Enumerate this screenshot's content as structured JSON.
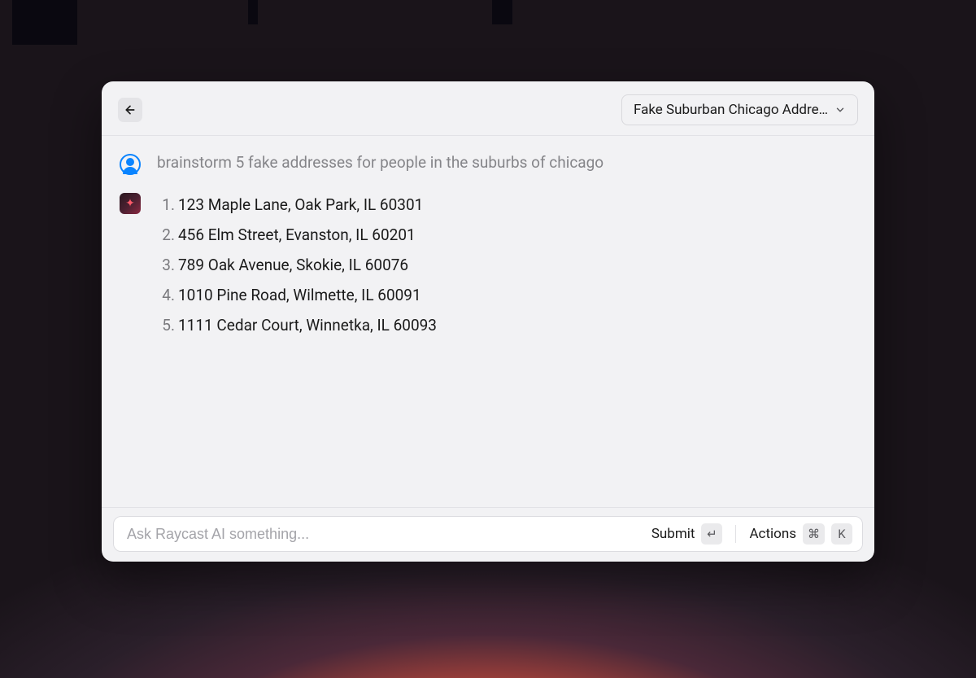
{
  "header": {
    "dropdown_label": "Fake Suburban Chicago Addre…"
  },
  "conversation": {
    "user_prompt": "brainstorm 5 fake addresses for people in the suburbs of chicago",
    "ai_response_items": [
      "123 Maple Lane, Oak Park, IL 60301",
      "456 Elm Street, Evanston, IL 60201",
      "789 Oak Avenue, Skokie, IL 60076",
      "1010 Pine Road, Wilmette, IL 60091",
      "1111 Cedar Court, Winnetka, IL 60093"
    ]
  },
  "footer": {
    "input_placeholder": "Ask Raycast AI something...",
    "submit_label": "Submit",
    "submit_key": "↵",
    "actions_label": "Actions",
    "actions_key1": "⌘",
    "actions_key2": "K"
  }
}
